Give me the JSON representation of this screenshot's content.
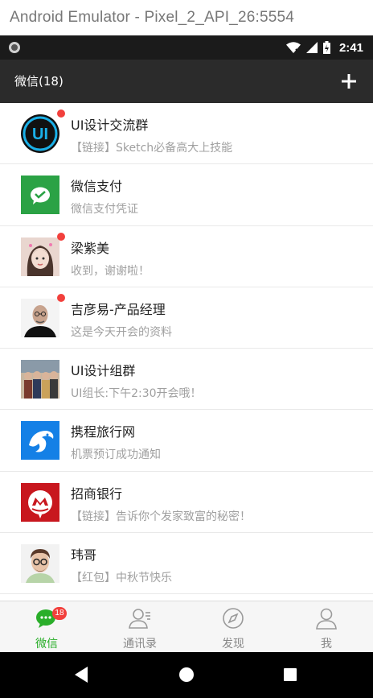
{
  "window": {
    "title": "Android Emulator - Pixel_2_API_26:5554"
  },
  "statusbar": {
    "time": "2:41",
    "icons": [
      "wifi-icon",
      "signal-icon",
      "battery-icon"
    ]
  },
  "appbar": {
    "title": "微信(18)",
    "action_icon": "plus-icon"
  },
  "chats": [
    {
      "name": "UI设计交流群",
      "message": "【链接】Sketch必备高大上技能",
      "unread": true,
      "avatar": "ui-group-avatar"
    },
    {
      "name": "微信支付",
      "message": "微信支付凭证",
      "unread": false,
      "avatar": "wechat-pay-avatar"
    },
    {
      "name": "梁紫美",
      "message": "收到，谢谢啦！",
      "unread": true,
      "avatar": "girl-photo-avatar"
    },
    {
      "name": "吉彦易-产品经理",
      "message": "这是今天开会的资料",
      "unread": true,
      "avatar": "man-photo-avatar"
    },
    {
      "name": "UI设计组群",
      "message": "UI组长:下午2:30开会哦！",
      "unread": false,
      "avatar": "group-photo-avatar"
    },
    {
      "name": "携程旅行网",
      "message": "机票预订成功通知",
      "unread": false,
      "avatar": "ctrip-avatar"
    },
    {
      "name": "招商银行",
      "message": "【链接】告诉你个发家致富的秘密！",
      "unread": false,
      "avatar": "cmb-avatar"
    },
    {
      "name": "玮哥",
      "message": "【红包】中秋节快乐",
      "unread": false,
      "avatar": "cartoon-man-avatar"
    }
  ],
  "tabs": [
    {
      "label": "微信",
      "badge": "18",
      "active": true,
      "icon": "chat-bubble-icon"
    },
    {
      "label": "通讯录",
      "active": false,
      "icon": "contacts-icon"
    },
    {
      "label": "发现",
      "active": false,
      "icon": "compass-icon"
    },
    {
      "label": "我",
      "active": false,
      "icon": "person-icon"
    }
  ],
  "colors": {
    "accent": "#2aae2a",
    "unread_dot": "#f2403c",
    "appbar": "#2b2b2b"
  }
}
